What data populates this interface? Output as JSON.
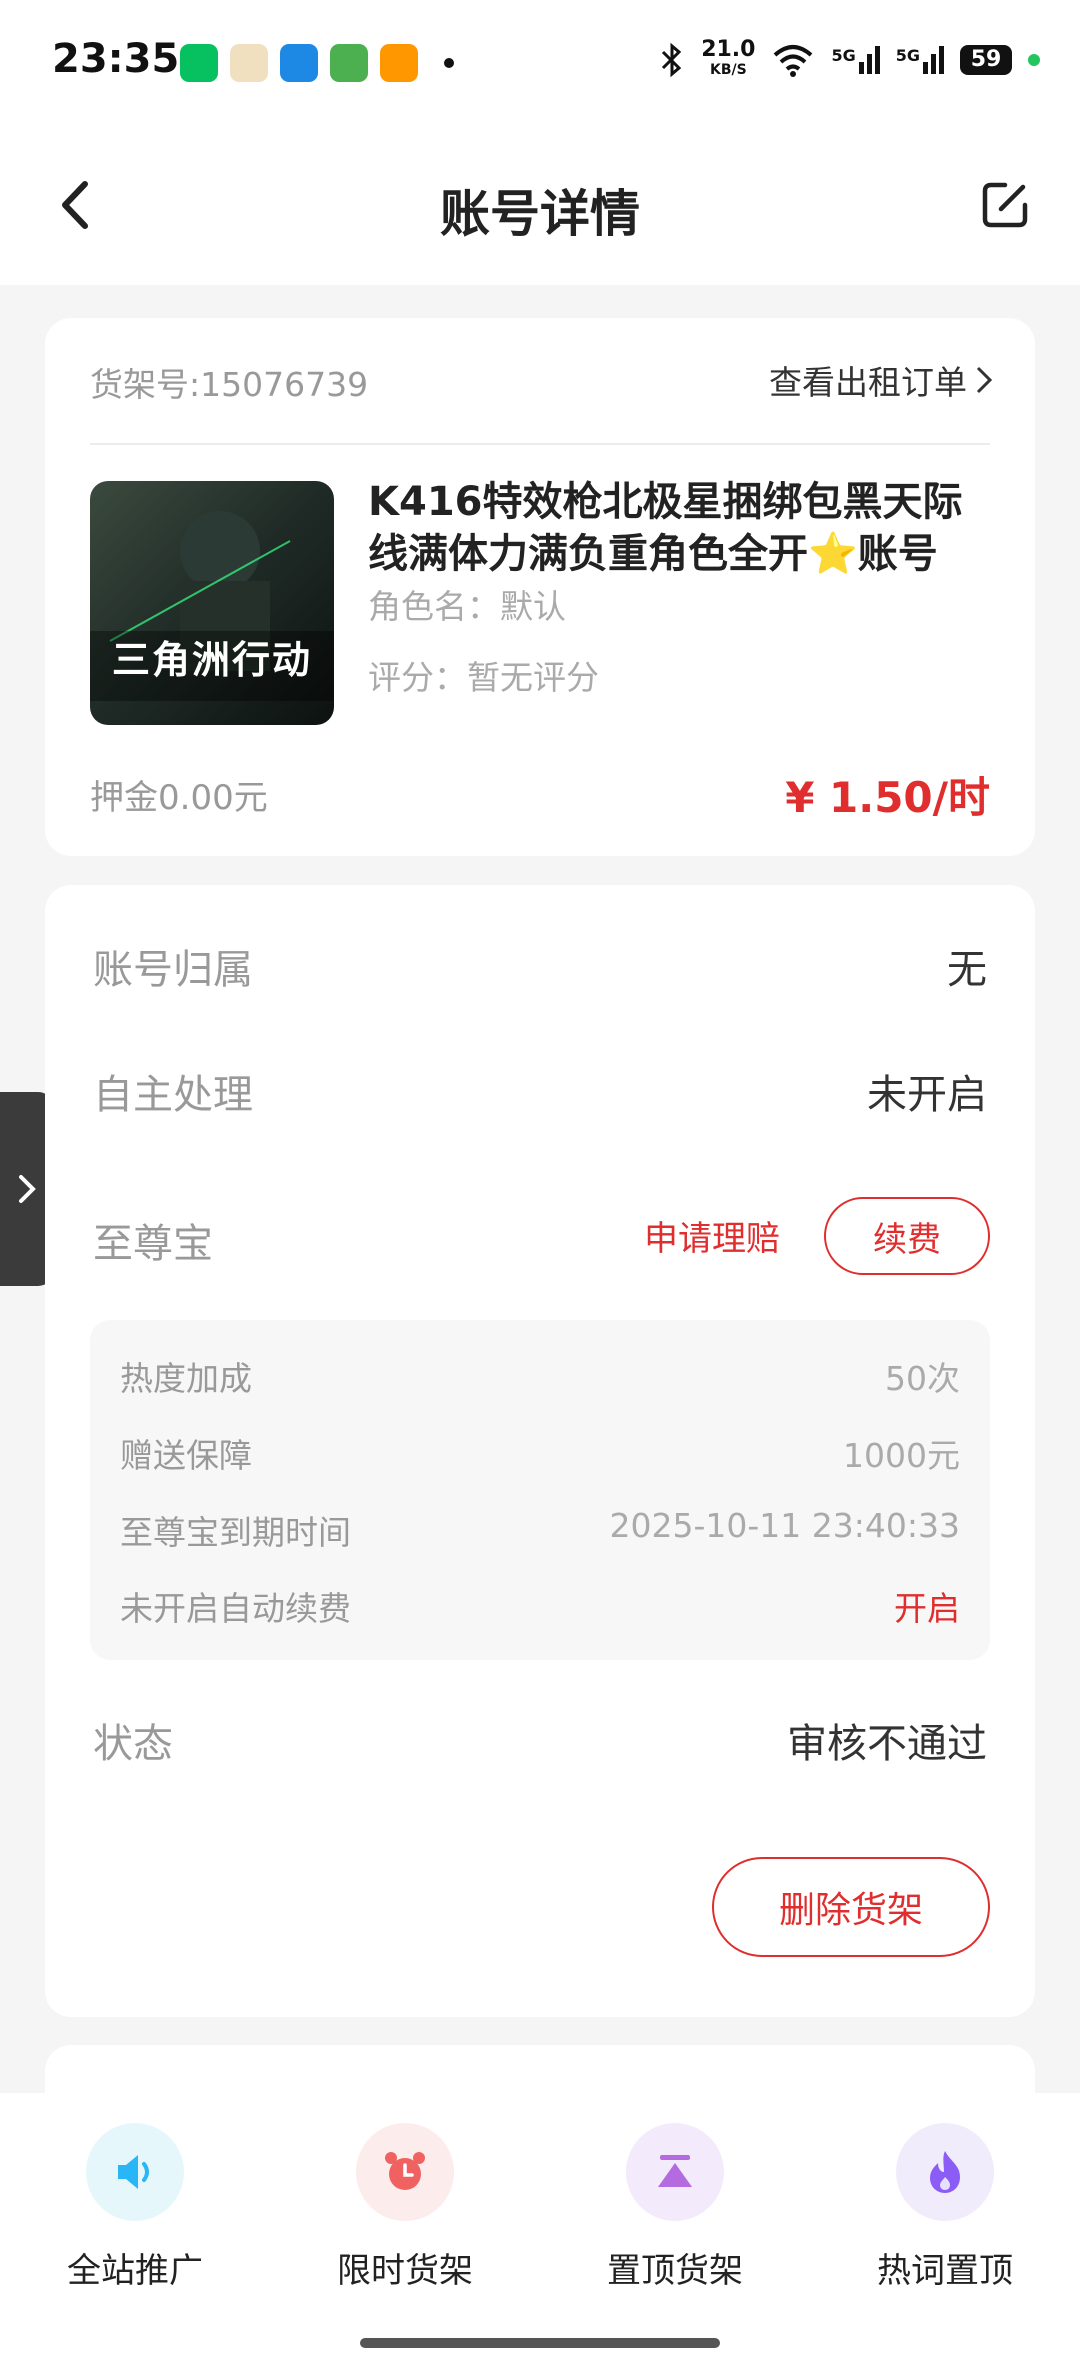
{
  "status_bar": {
    "time": "23:35",
    "net_speed": "21.0",
    "net_unit": "KB/S",
    "signal1": "5G",
    "signal2": "5G",
    "battery": "59"
  },
  "nav": {
    "title": "账号详情"
  },
  "listing": {
    "shelf_no": "货架号:15076739",
    "view_orders": "查看出租订单",
    "game_logo": "三角洲行动",
    "title": "K416特效枪北极星捆绑包黑天际线满体力满负重角色全开⭐账号",
    "role_name": "角色名：默认",
    "rating": "评分：暂无评分",
    "deposit": "押金0.00元",
    "price": "¥ 1.50/时"
  },
  "details": {
    "ownership_label": "账号归属",
    "ownership_value": "无",
    "self_process_label": "自主处理",
    "self_process_value": "未开启",
    "supreme_label": "至尊宝",
    "claim_label": "申请理赔",
    "renew_label": "续费",
    "supreme_rows": [
      {
        "key": "热度加成",
        "value": "50次"
      },
      {
        "key": "赠送保障",
        "value": "1000元"
      },
      {
        "key": "至尊宝到期时间",
        "value": "2025-10-11 23:40:33"
      },
      {
        "key": "未开启自动续费",
        "value": "开启"
      }
    ],
    "status_label": "状态",
    "status_value": "审核不通过",
    "delete_label": "删除货架"
  },
  "bottom_bar": [
    {
      "label": "全站推广",
      "icon": "speaker-icon"
    },
    {
      "label": "限时货架",
      "icon": "alarm-clock-icon"
    },
    {
      "label": "置顶货架",
      "icon": "pin-top-icon"
    },
    {
      "label": "热词置顶",
      "icon": "flame-icon"
    }
  ],
  "colors": {
    "accent_red": "#e02e2e",
    "speaker_bg": "#e6f7fc",
    "alarm_bg": "#fdecec",
    "pin_bg": "#f3eafc",
    "flame_bg": "#f1ecfb"
  }
}
